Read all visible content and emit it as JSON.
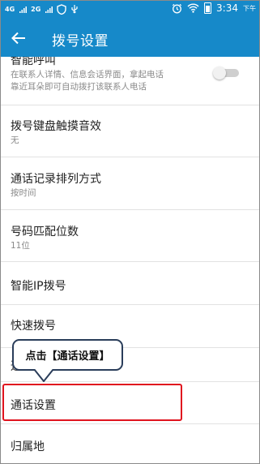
{
  "status_bar": {
    "signal_4g": "4G",
    "signal_2g": "2G",
    "time": "3:34",
    "ampm": "下午"
  },
  "app_bar": {
    "title": "拨号设置"
  },
  "settings": [
    {
      "title": "智能呼叫",
      "subtitle_line1": "在联系人详情、信息会话界面，拿起电话",
      "subtitle_line2": "靠近耳朵即可自动拨打该联系人电话",
      "toggle_on": false
    },
    {
      "title": "拨号键盘触摸音效",
      "subtitle": "无"
    },
    {
      "title": "通话记录排列方式",
      "subtitle": "按时间"
    },
    {
      "title": "号码匹配位数",
      "subtitle": "11位"
    },
    {
      "title": "智能IP拨号"
    },
    {
      "title": "快速拨号"
    },
    {
      "title": "通"
    },
    {
      "title": "通话设置"
    },
    {
      "title": "归属地"
    }
  ],
  "callout": {
    "text": "点击【通话设置】"
  },
  "colors": {
    "primary": "#1689c9",
    "highlight_border": "#e0141e",
    "callout_border": "#2a3d5a"
  }
}
